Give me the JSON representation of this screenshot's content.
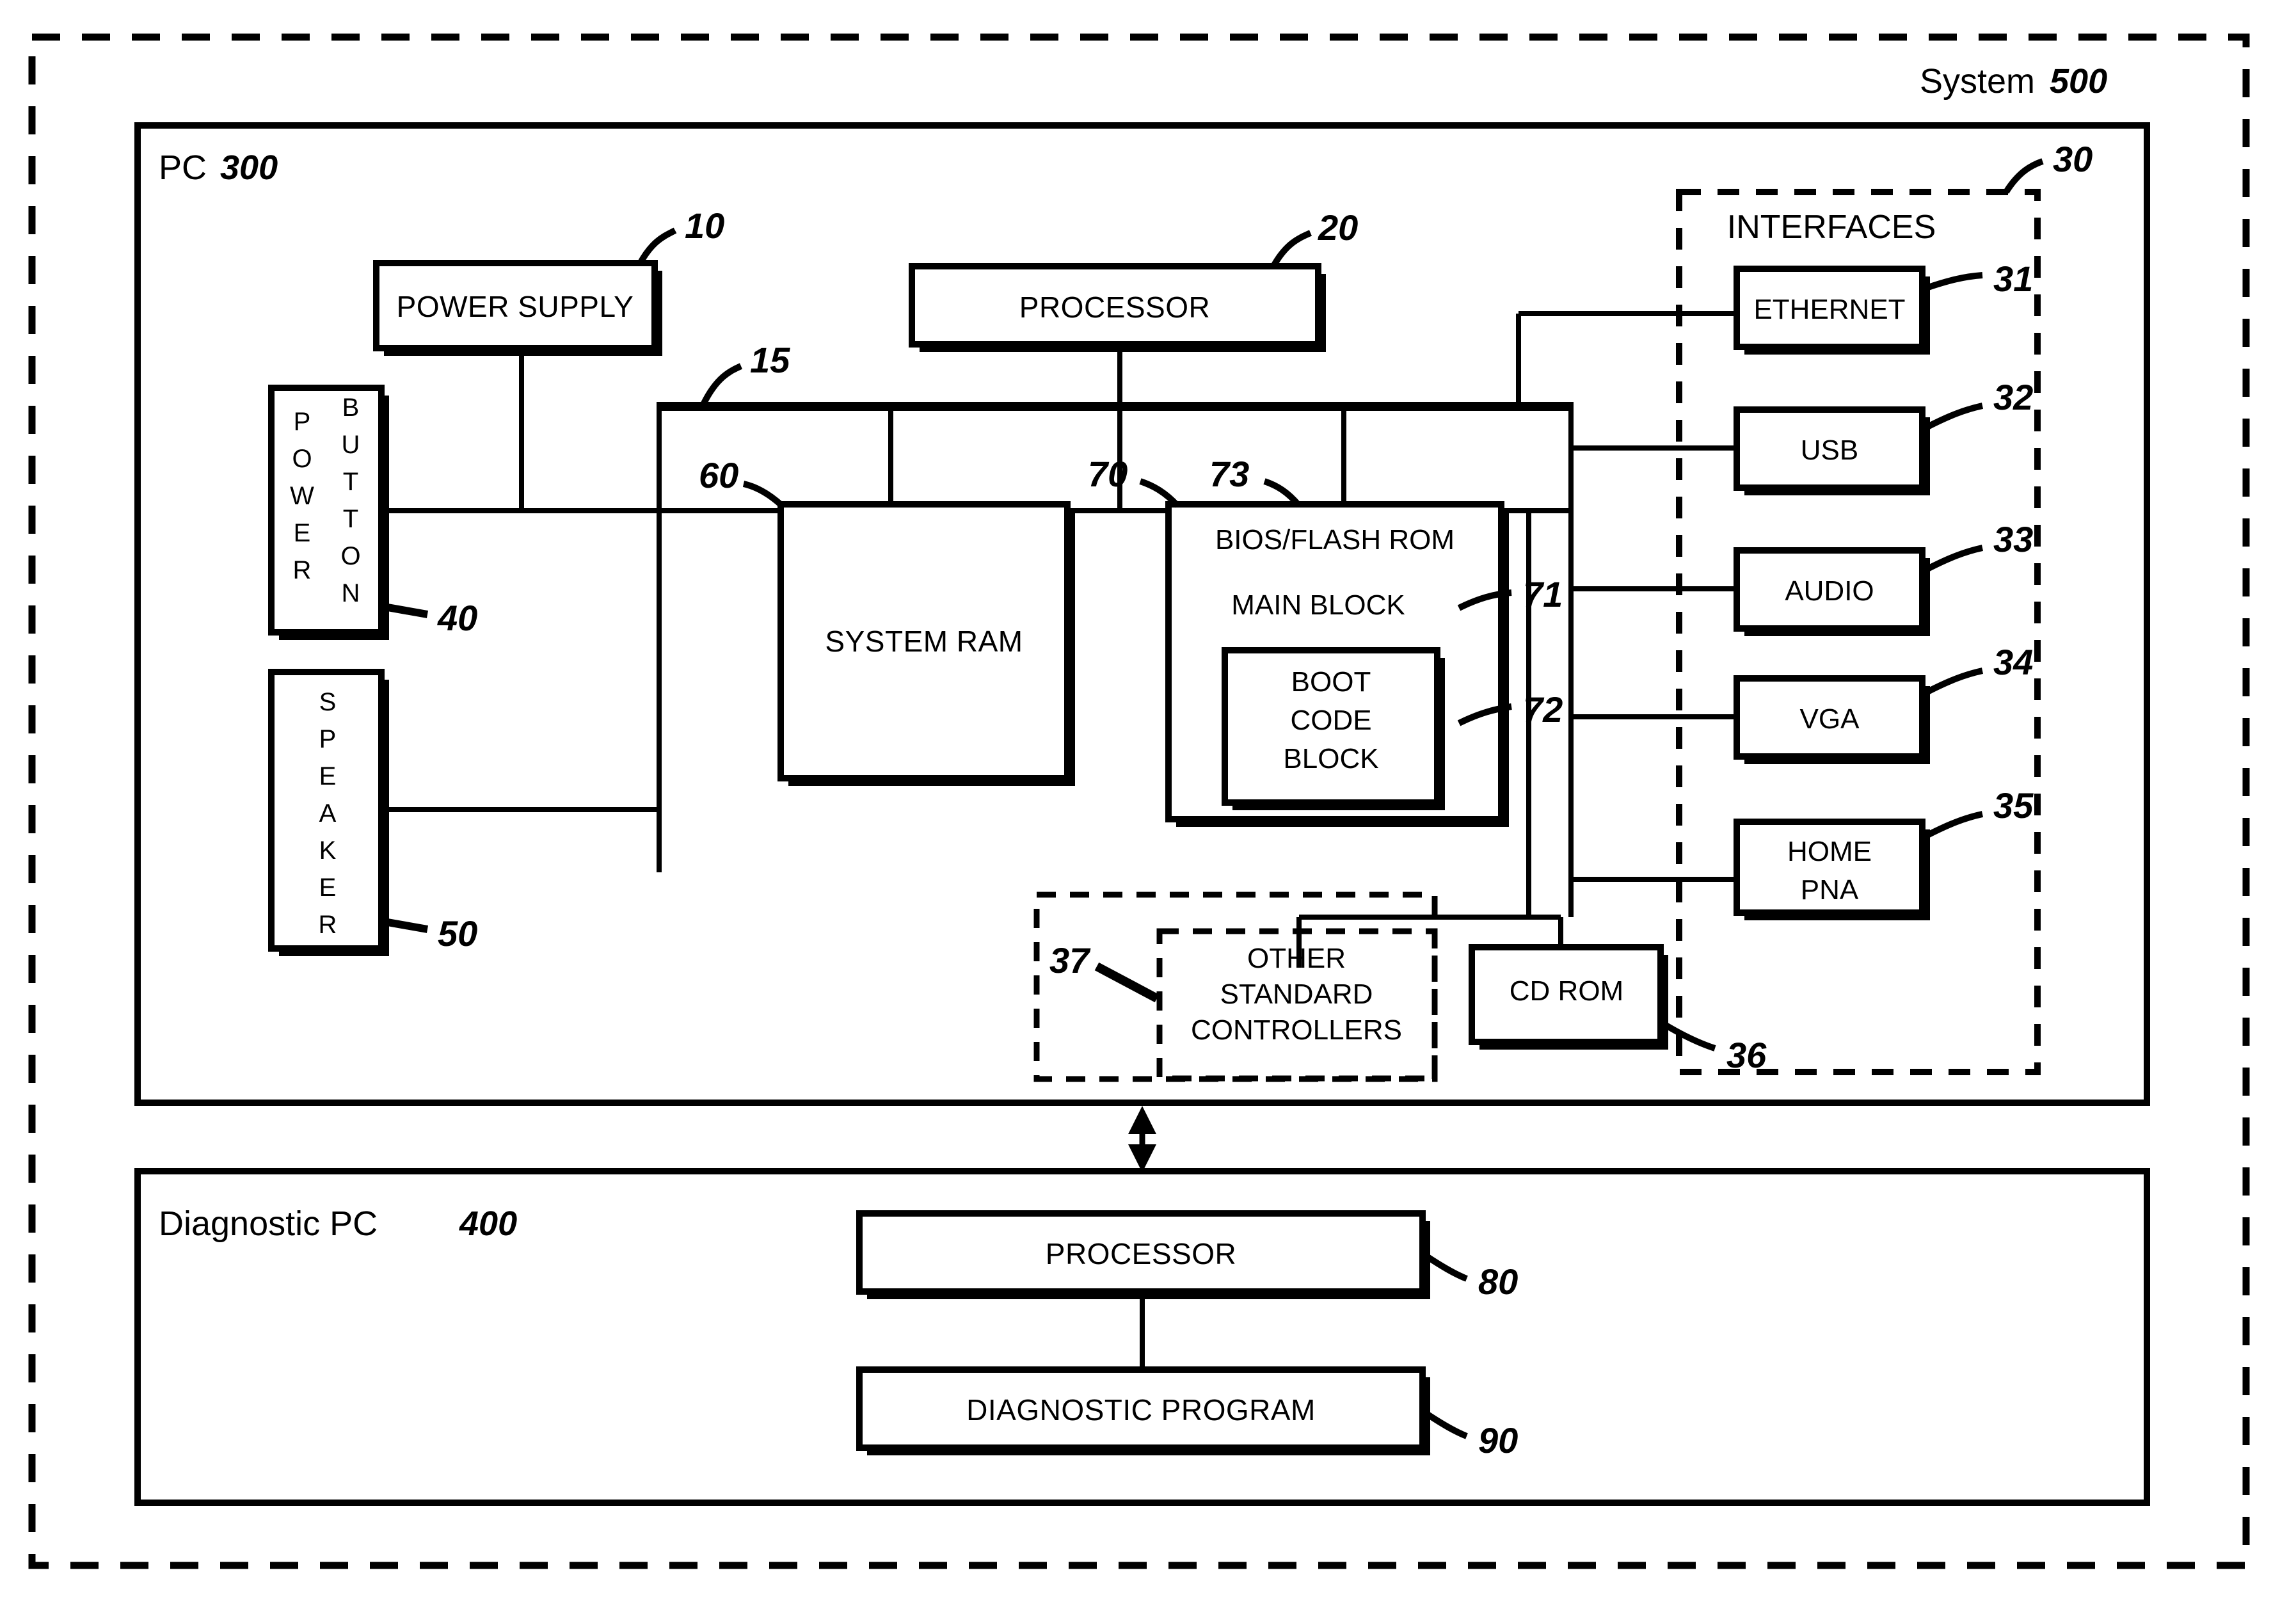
{
  "outer": {
    "label": "System",
    "ref": "500"
  },
  "pc": {
    "label": "PC",
    "ref": "300"
  },
  "diagnostic_pc": {
    "label": "Diagnostic PC",
    "ref": "400"
  },
  "blocks": {
    "power_supply": {
      "label": "POWER SUPPLY",
      "ref": "10"
    },
    "processor": {
      "label": "PROCESSOR",
      "ref": "20"
    },
    "bus": {
      "ref": "15"
    },
    "power_button": {
      "label_line1": "POWER",
      "label_line2": "BUTTON",
      "ref": "40"
    },
    "speaker": {
      "label": "SPEAKER",
      "ref": "50"
    },
    "system_ram": {
      "label": "SYSTEM RAM",
      "ref": "60"
    },
    "bios_flash_rom": {
      "label": "BIOS/FLASH ROM",
      "ref": "70",
      "ref_alt": "73"
    },
    "main_block": {
      "label": "MAIN BLOCK",
      "ref": "71"
    },
    "boot_code_block": {
      "line1": "BOOT",
      "line2": "CODE",
      "line3": "BLOCK",
      "ref": "72"
    },
    "other_standard_controllers": {
      "line1": "OTHER",
      "line2": "STANDARD",
      "line3": "CONTROLLERS",
      "ref": "37"
    },
    "cd_rom": {
      "label": "CD ROM",
      "ref": "36"
    },
    "diag_processor": {
      "label": "PROCESSOR",
      "ref": "80"
    },
    "diagnostic_program": {
      "label": "DIAGNOSTIC PROGRAM",
      "ref": "90"
    }
  },
  "interfaces": {
    "title": "INTERFACES",
    "ref": "30",
    "items": [
      {
        "label": "ETHERNET",
        "ref": "31"
      },
      {
        "label": "USB",
        "ref": "32"
      },
      {
        "label": "AUDIO",
        "ref": "33"
      },
      {
        "label": "VGA",
        "ref": "34"
      },
      {
        "label_line1": "HOME",
        "label_line2": "PNA",
        "ref": "35"
      }
    ]
  },
  "colors": {
    "ink": "#000000",
    "paper": "#ffffff"
  }
}
